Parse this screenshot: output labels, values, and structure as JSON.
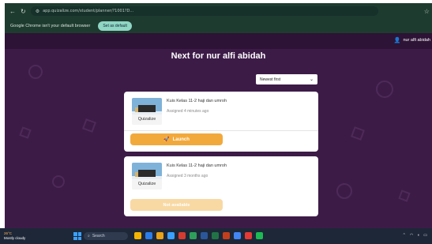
{
  "browser": {
    "url": "app.quizalize.com/student/planner/?1001?D...",
    "info_message": "Google Chrome isn't your default browser",
    "set_default_label": "Set as default"
  },
  "page": {
    "user_name": "nur alfi abidah",
    "title": "Next for nur alfi abidah",
    "sort_selected": "Newest first"
  },
  "assignments": [
    {
      "title": "Kuis Kelas 11-2 haji dan umroh",
      "time": "Assigned 4 minutes ago",
      "thumb_label": "Quizalize",
      "action_label": "Launch",
      "action_state": "enabled"
    },
    {
      "title": "Kuis Kelas 11-2 haji dan umroh",
      "time": "Assigned 3 months ago",
      "thumb_label": "Quizalize",
      "action_label": "Not available",
      "action_state": "disabled"
    }
  ],
  "taskbar": {
    "temp": "26°C",
    "weather_desc": "Mostly cloudy",
    "search_label": "Search"
  },
  "colors": {
    "page_bg": "#3d1b47",
    "accent_orange": "#f2a93b",
    "chrome_bg": "#1e3b2f"
  }
}
